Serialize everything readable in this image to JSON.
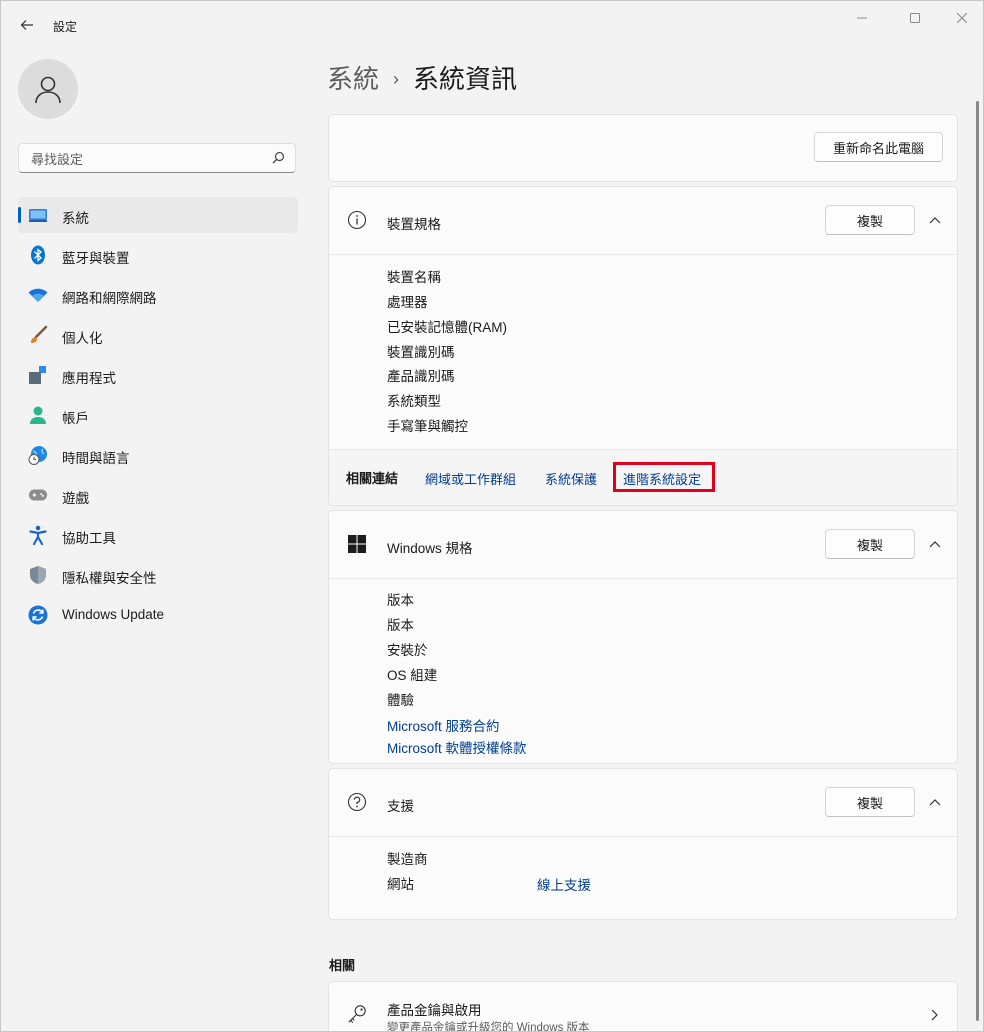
{
  "app": {
    "title": "設定"
  },
  "search": {
    "placeholder": "尋找設定"
  },
  "sidebar": {
    "items": [
      {
        "label": "系統",
        "icon": "system-display-icon",
        "active": true
      },
      {
        "label": "藍牙與裝置",
        "icon": "bluetooth-icon"
      },
      {
        "label": "網路和網際網路",
        "icon": "wifi-icon"
      },
      {
        "label": "個人化",
        "icon": "brush-icon"
      },
      {
        "label": "應用程式",
        "icon": "apps-icon"
      },
      {
        "label": "帳戶",
        "icon": "account-icon"
      },
      {
        "label": "時間與語言",
        "icon": "globe-clock-icon"
      },
      {
        "label": "遊戲",
        "icon": "gamepad-icon"
      },
      {
        "label": "協助工具",
        "icon": "accessibility-icon"
      },
      {
        "label": "隱私權與安全性",
        "icon": "shield-icon"
      },
      {
        "label": "Windows Update",
        "icon": "update-icon"
      }
    ]
  },
  "breadcrumb": {
    "parent": "系統",
    "separator": "›",
    "current": "系統資訊"
  },
  "rename": {
    "label": "重新命名此電腦"
  },
  "device_specs": {
    "title": "裝置規格",
    "copy_label": "複製",
    "rows": [
      "裝置名稱",
      "處理器",
      "已安裝記憶體(RAM)",
      "裝置識別碼",
      "產品識別碼",
      "系統類型",
      "手寫筆與觸控"
    ]
  },
  "related_links": {
    "label": "相關連結",
    "links": [
      "網域或工作群組",
      "系統保護",
      "進階系統設定"
    ]
  },
  "windows_specs": {
    "title": "Windows 規格",
    "copy_label": "複製",
    "rows": [
      "版本",
      "版本",
      "安裝於",
      "OS 組建",
      "體驗"
    ],
    "links": [
      "Microsoft 服務合約",
      "Microsoft 軟體授權條款"
    ]
  },
  "support": {
    "title": "支援",
    "copy_label": "複製",
    "rows": [
      "製造商",
      "網站"
    ],
    "website_link": "線上支援"
  },
  "related": {
    "label": "相關",
    "items": [
      {
        "title": "產品金鑰與啟用",
        "subtitle": "變更產品金鑰或升級您的 Windows 版本"
      }
    ]
  },
  "colors": {
    "accent": "#005fb8",
    "link": "#003e92",
    "highlight": "#e0001b"
  }
}
